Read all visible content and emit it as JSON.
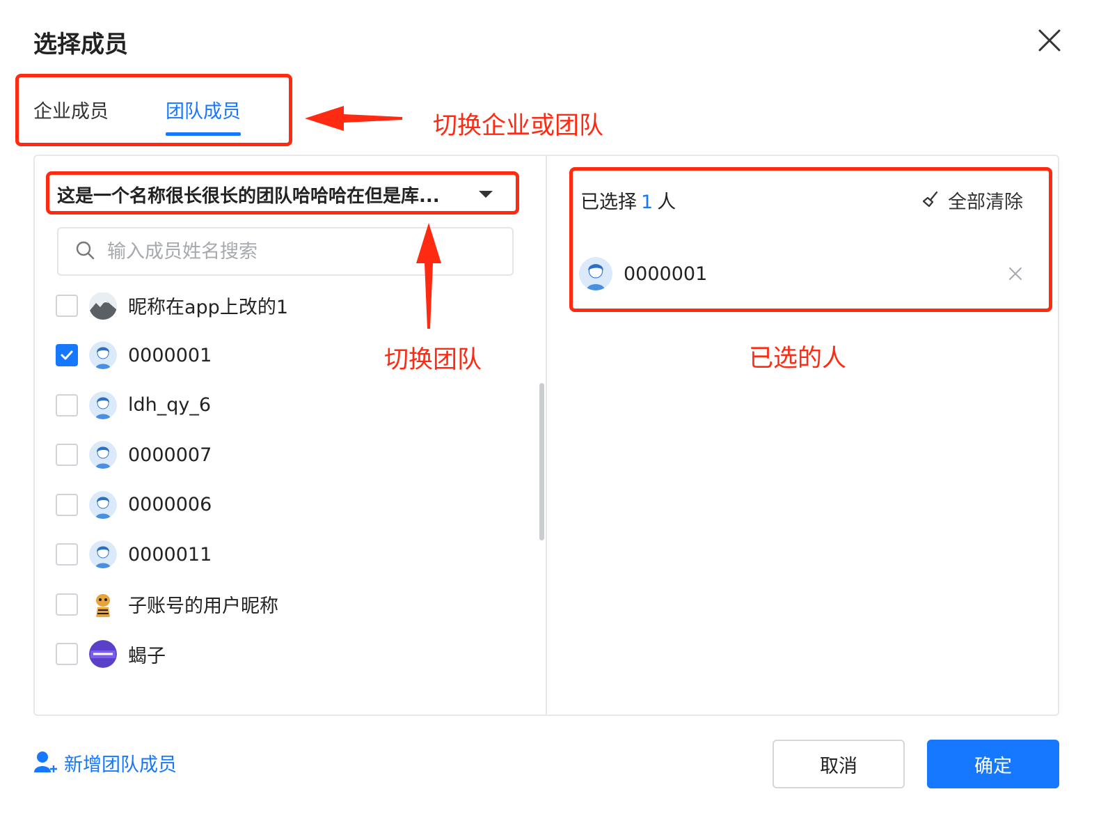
{
  "dialog": {
    "title": "选择成员"
  },
  "tabs": [
    {
      "label": "企业成员",
      "active": false
    },
    {
      "label": "团队成员",
      "active": true
    }
  ],
  "team_select": {
    "value": "这是一个名称很长很长的团队哈哈哈在但是库..."
  },
  "search": {
    "placeholder": "输入成员姓名搜索",
    "value": ""
  },
  "members": [
    {
      "name": "昵称在app上改的1",
      "checked": false,
      "avatar": "mountain-photo-avatar"
    },
    {
      "name": "0000001",
      "checked": true,
      "avatar": "default-user-avatar"
    },
    {
      "name": "ldh_qy_6",
      "checked": false,
      "avatar": "default-user-avatar"
    },
    {
      "name": "0000007",
      "checked": false,
      "avatar": "default-user-avatar"
    },
    {
      "name": "0000006",
      "checked": false,
      "avatar": "default-user-avatar"
    },
    {
      "name": "0000011",
      "checked": false,
      "avatar": "default-user-avatar"
    },
    {
      "name": "子账号的用户昵称",
      "checked": false,
      "avatar": "tiger-cartoon-avatar"
    },
    {
      "name": "蝎子",
      "checked": false,
      "avatar": "purple-poster-avatar"
    }
  ],
  "selected": {
    "prefix": "已选择",
    "count": "1",
    "suffix": "人",
    "clear_all_label": "全部清除",
    "items": [
      {
        "name": "0000001",
        "avatar": "default-user-avatar"
      }
    ]
  },
  "footer": {
    "add_member_label": "新增团队成员",
    "cancel_label": "取消",
    "confirm_label": "确定"
  },
  "annotations": {
    "switch_tab": "切换企业或团队",
    "switch_team": "切换团队",
    "selected_people": "已选的人"
  },
  "colors": {
    "accent": "#1677ff",
    "annotation": "#ff2a12",
    "border": "#e6e8eb"
  }
}
